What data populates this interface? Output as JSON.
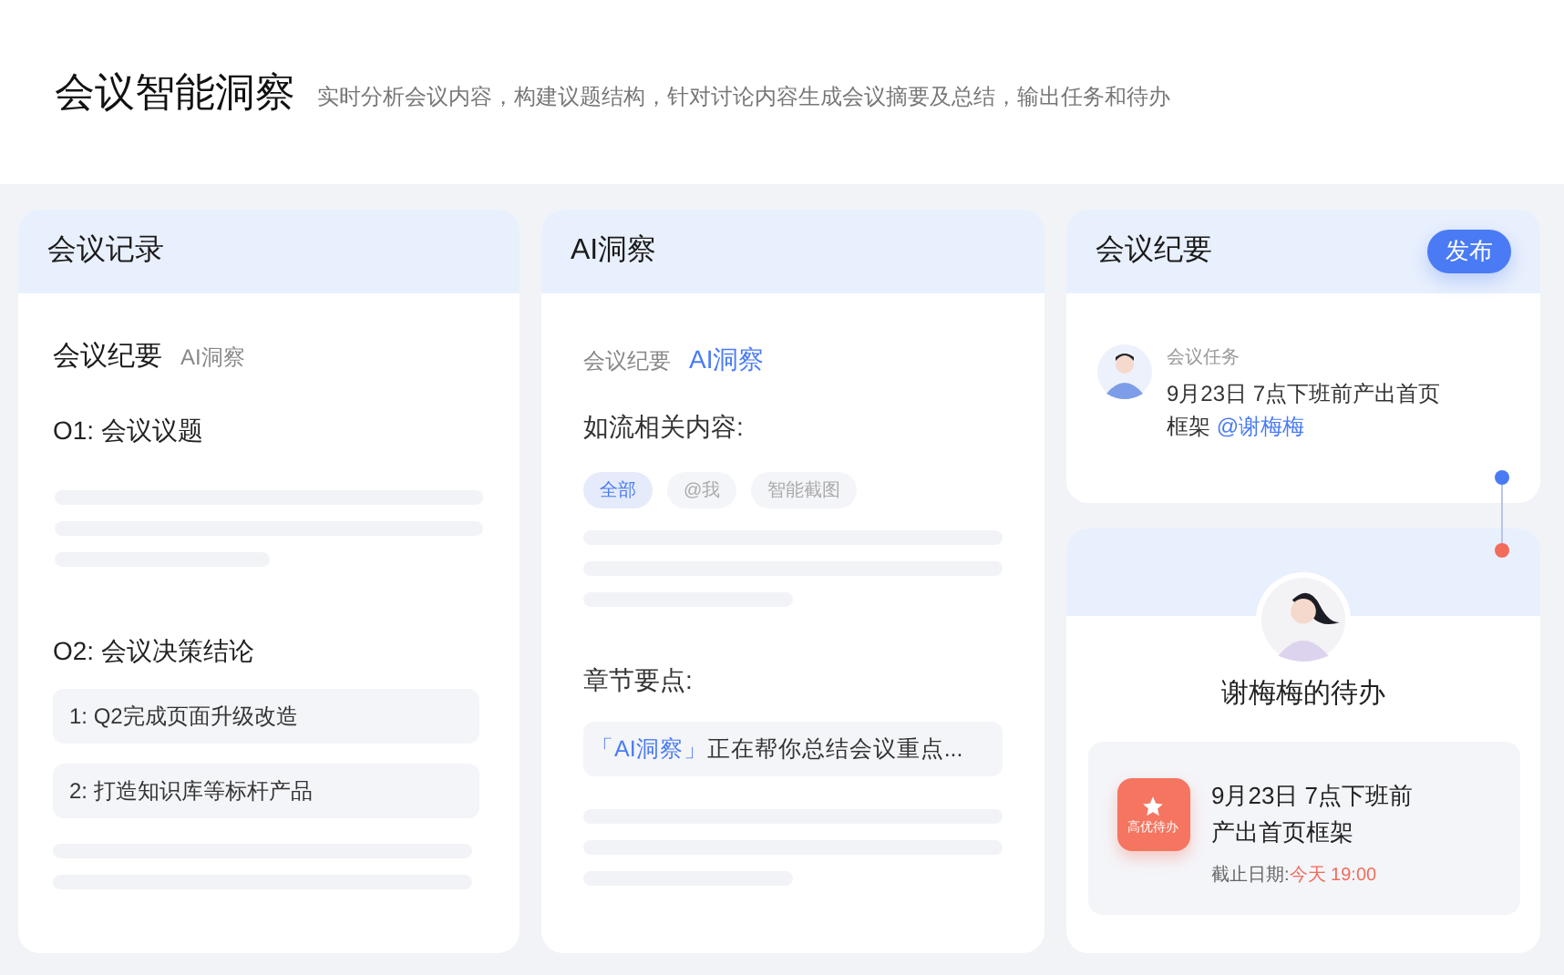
{
  "header": {
    "title": "会议智能洞察",
    "subtitle": "实时分析会议内容，构建议题结构，针对讨论内容生成会议摘要及总结，输出任务和待办"
  },
  "record_panel": {
    "title": "会议记录",
    "tabs": [
      {
        "label": "会议纪要",
        "selected": true
      },
      {
        "label": "AI洞察",
        "selected": false
      }
    ],
    "topic_1": "O1: 会议议题",
    "topic_2": "O2: 会议决策结论",
    "decisions": [
      "1: Q2完成页面升级改造",
      "2: 打造知识库等标杆产品"
    ]
  },
  "insight_panel": {
    "title": "AI洞察",
    "tabs": [
      {
        "label": "会议纪要",
        "selected": false
      },
      {
        "label": "AI洞察",
        "selected": true
      }
    ],
    "related_heading": "如流相关内容:",
    "filters": [
      {
        "label": "全部",
        "selected": true
      },
      {
        "label": "@我",
        "selected": false
      },
      {
        "label": "智能截图",
        "selected": false
      }
    ],
    "chapter_heading": "章节要点:",
    "chapter_status_tag": "「AI洞察」",
    "chapter_status": "正在帮你总结会议重点..."
  },
  "summary_panel": {
    "title": "会议纪要",
    "publish_button": "发布",
    "task_label": "会议任务",
    "task_text": "9月23日 7点下班前产出首页框架",
    "task_mention": "@谢梅梅"
  },
  "todo_card": {
    "title": "谢梅梅的待办",
    "badge": "高优待办",
    "task_text": "9月23日 7点下班前产出首页框架",
    "deadline_label": "截止日期:",
    "deadline_value": "今天 19:00"
  }
}
